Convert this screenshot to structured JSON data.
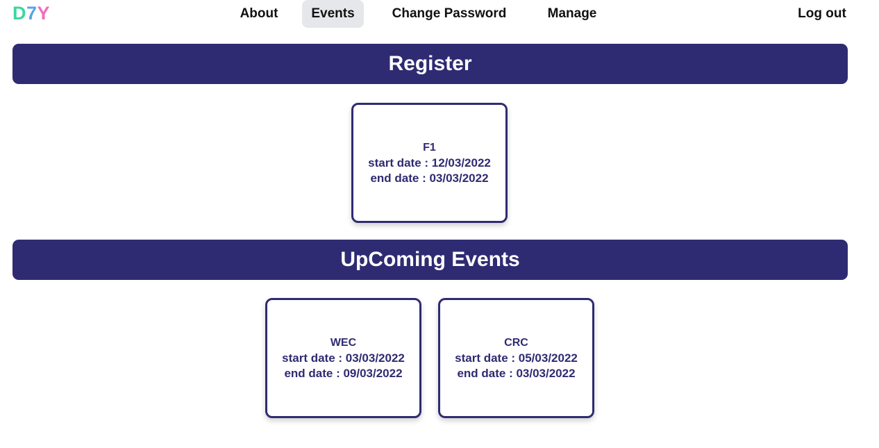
{
  "nav": {
    "logo": [
      "D",
      "7",
      "Y"
    ],
    "links": [
      "About",
      "Events",
      "Change Password",
      "Manage"
    ],
    "logout": "Log out"
  },
  "register": {
    "title": "Register",
    "events": [
      {
        "name": "F1",
        "start": "start date : 12/03/2022",
        "end": "end date : 03/03/2022"
      }
    ]
  },
  "upcoming": {
    "title": "UpComing Events",
    "events": [
      {
        "name": "WEC",
        "start": "start date : 03/03/2022",
        "end": "end date : 09/03/2022"
      },
      {
        "name": "CRC",
        "start": "start date : 05/03/2022",
        "end": "end date : 03/03/2022"
      }
    ]
  },
  "colors": {
    "brand_dark": "#2f2b72",
    "logo": [
      "#3dd6a0",
      "#5aa2ea",
      "#f06bbd"
    ],
    "active_nav_bg": "#e6e7ea"
  }
}
